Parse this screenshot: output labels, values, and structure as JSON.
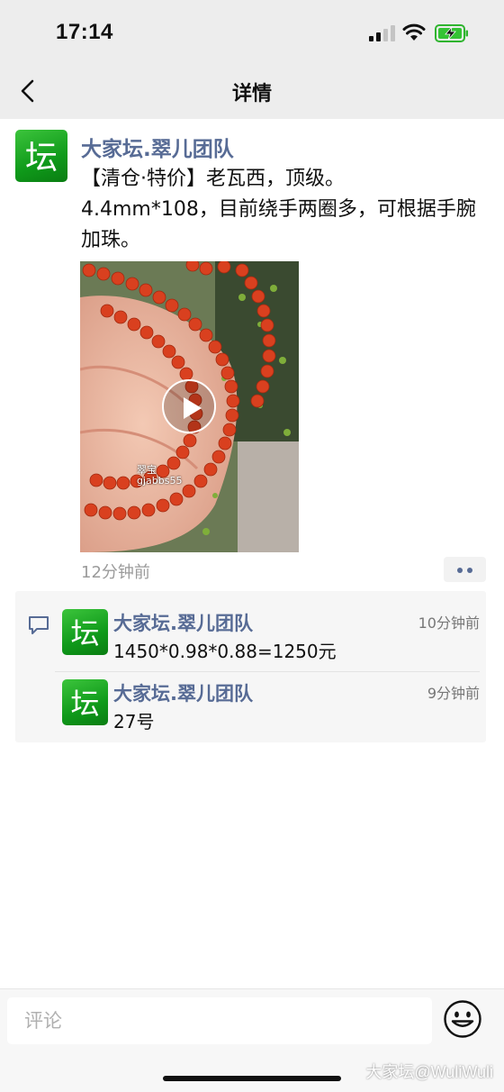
{
  "status_bar": {
    "time": "17:14"
  },
  "nav": {
    "title": "详情"
  },
  "post": {
    "author": "大家坛.翠儿团队",
    "text": "【清仓·特价】老瓦西，顶级。\n4.4mm*108，目前绕手两圈多，可根据手腕加珠。",
    "media_watermark": "翠宝",
    "media_watermark_id": "gjabbs55",
    "timestamp": "12分钟前",
    "avatar_glyph": "坛"
  },
  "comments": [
    {
      "author": "大家坛.翠儿团队",
      "text": "1450*0.98*0.88=1250元",
      "time": "10分钟前"
    },
    {
      "author": "大家坛.翠儿团队",
      "text": "27号",
      "time": "9分钟前"
    }
  ],
  "input": {
    "placeholder": "评论"
  },
  "watermark": "大家坛@WuliWuli",
  "colors": {
    "link": "#576b95",
    "avatar_green": "#1aa321",
    "background": "#ededed"
  }
}
